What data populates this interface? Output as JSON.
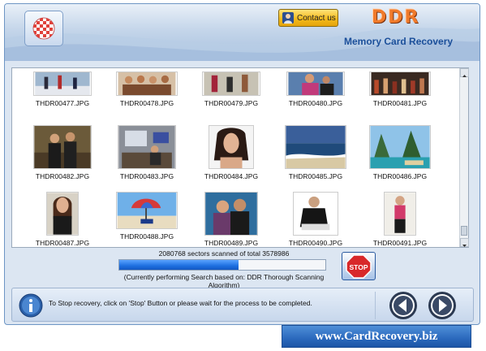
{
  "header": {
    "contact_label": "Contact us",
    "brand": "DDR",
    "subtitle": "Memory Card Recovery"
  },
  "gallery": {
    "files": [
      "THDR00477.JPG",
      "THDR00478.JPG",
      "THDR00479.JPG",
      "THDR00480.JPG",
      "THDR00481.JPG",
      "THDR00482.JPG",
      "THDR00483.JPG",
      "THDR00484.JPG",
      "THDR00485.JPG",
      "THDR00486.JPG",
      "THDR00487.JPG",
      "THDR00488.JPG",
      "THDR00489.JPG",
      "THDR00490.JPG",
      "THDR00491.JPG"
    ]
  },
  "progress": {
    "sectors_text": "2080768 sectors scanned of total 3578986",
    "fraction": 0.58,
    "algorithm_text": "(Currently performing Search based on:  DDR Thorough Scanning Algorithm)"
  },
  "stop_label": "STOP",
  "footer": {
    "message": "To Stop recovery, click on 'Stop' Button or please wait for the process to be completed."
  },
  "website": "www.CardRecovery.biz",
  "icons": {
    "logo": "checkered-ball-icon",
    "contact": "person-icon",
    "info": "info-icon",
    "back": "back-arrow-icon",
    "next": "next-arrow-icon"
  }
}
